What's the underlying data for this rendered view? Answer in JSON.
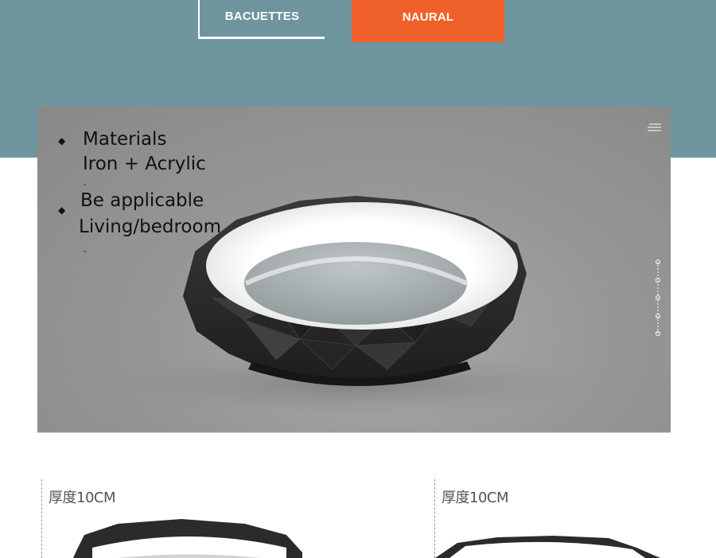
{
  "tabs": [
    {
      "label": "BACUETTES",
      "style": "outline"
    },
    {
      "label": "NAURAL",
      "style": "filled"
    }
  ],
  "colors": {
    "band": "#6e959d",
    "accent": "#f0602a",
    "hero_bg": "#979797",
    "text": "#111111"
  },
  "hero": {
    "specs": [
      {
        "title": "Materials",
        "value": "Iron + Acrylic",
        "separator": "-"
      },
      {
        "title": "Be applicable",
        "value": "Living/bedroom",
        "separator": "-"
      }
    ],
    "menu_icon": "hamburger-menu-icon",
    "slider_icon": "slider-dots-icon"
  },
  "details": [
    {
      "label": "厚度10CM"
    },
    {
      "label": "厚度10CM"
    }
  ]
}
